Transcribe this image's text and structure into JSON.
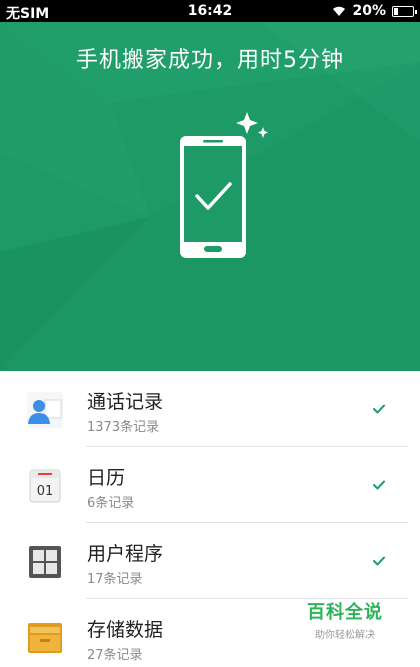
{
  "status_bar": {
    "carrier": "无SIM",
    "time": "16:42",
    "battery": "20%"
  },
  "hero": {
    "title": "手机搬家成功，用时5分钟",
    "background_color": "#1e9a66"
  },
  "items": [
    {
      "title": "通话记录",
      "subtitle": "1373条记录",
      "icon": "call-log-icon"
    },
    {
      "title": "日历",
      "subtitle": "6条记录",
      "icon": "calendar-icon",
      "icon_text": "01"
    },
    {
      "title": "用户程序",
      "subtitle": "17条记录",
      "icon": "apps-grid-icon"
    },
    {
      "title": "存储数据",
      "subtitle": "27条记录",
      "icon": "storage-folder-icon"
    }
  ],
  "check_color": "#1e9a66",
  "watermark": {
    "main": "百科全说",
    "sub": "助你轻松解决"
  }
}
